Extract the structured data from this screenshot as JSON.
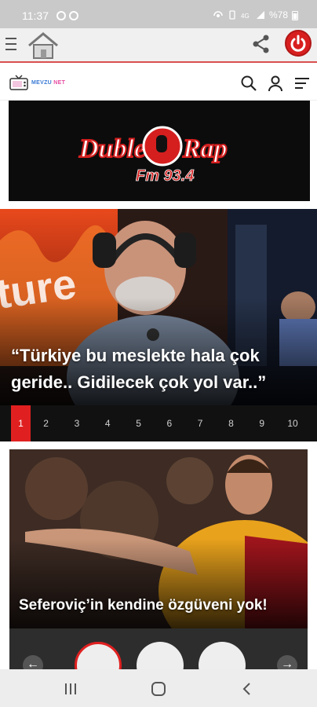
{
  "status_bar": {
    "time": "11:37",
    "right_text": "%78",
    "icons": [
      "whatsapp-icon",
      "check-icon",
      "hotspot-icon",
      "vibrate-icon",
      "4g-icon",
      "signal-icon",
      "battery-icon"
    ]
  },
  "app_bar": {
    "icons": [
      "menu-icon",
      "home-icon",
      "share-icon",
      "power-icon"
    ],
    "accent": "#d8504f",
    "power_color": "#d81f1f"
  },
  "site_header": {
    "logo_text": "MEVZU",
    "logo_suffix": "NET",
    "icons": [
      "search-icon",
      "user-icon",
      "filter-menu-icon"
    ]
  },
  "banner": {
    "brand_line1_left": "Duble",
    "brand_line1_right": "Rap",
    "brand_line2": "Fm 93.4"
  },
  "slider": {
    "background_word": "ture",
    "title": "“Türkiye bu meslekte hala çok geride.. Gidilecek çok yol var..”",
    "pages": [
      "1",
      "2",
      "3",
      "4",
      "5",
      "6",
      "7",
      "8",
      "9",
      "10"
    ],
    "active_page": "1",
    "active_color": "#e02020"
  },
  "news_card": {
    "title": "Seferoviç’in kendine özgüveni yok!"
  },
  "author_strip": {
    "prev_icon": "arrow-left-icon",
    "next_icon": "arrow-right-icon"
  },
  "nav_bar": {
    "icons": [
      "recents-icon",
      "home-icon",
      "back-icon"
    ]
  }
}
